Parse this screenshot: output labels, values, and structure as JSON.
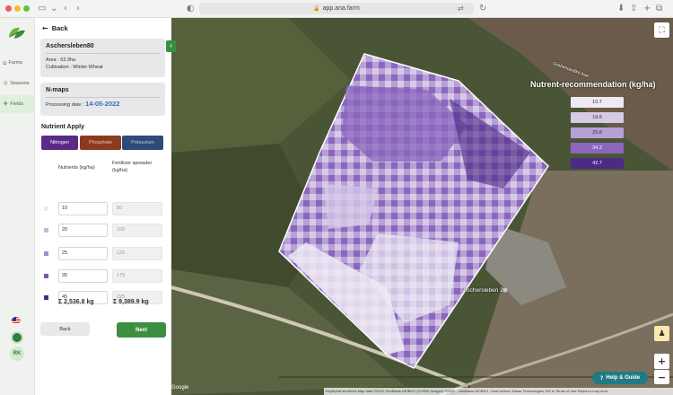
{
  "browser": {
    "url": "app.ana.farm"
  },
  "sidebar": {
    "items": [
      {
        "label": "Farms",
        "icon": "farm-icon"
      },
      {
        "label": "Seasons",
        "icon": "seasons-icon"
      },
      {
        "label": "Fields",
        "icon": "fields-icon",
        "active": true
      }
    ],
    "avatar_initials": "RK"
  },
  "panel": {
    "back_label": "Back",
    "field": {
      "name": "Aschersleben80",
      "area": "Area : 63.3ha",
      "cultivation": "Cultivation : Winter Wheat"
    },
    "nmaps": {
      "title": "N-maps",
      "processing_label": "Processing date :",
      "processing_date": "14-05-2022"
    },
    "nutrient_apply_title": "Nutrient Apply",
    "tabs": [
      {
        "label": "Nitrogen",
        "color": "#5b2a86",
        "active": true
      },
      {
        "label": "Phosphate",
        "color": "#8b3a1f"
      },
      {
        "label": "Potassium",
        "color": "#2f4a78"
      }
    ],
    "col_nutrients": "Nutrients (kg/ha)",
    "col_spreader": "Fertilizer spreader (kg/ha)",
    "rows": [
      {
        "nutrient": "10",
        "spreader": "50",
        "color": "#eeeaf4"
      },
      {
        "nutrient": "20",
        "spreader": "100",
        "color": "#c9b9df"
      },
      {
        "nutrient": "25",
        "spreader": "125",
        "color": "#a68bca"
      },
      {
        "nutrient": "35",
        "spreader": "175",
        "color": "#7c58ae"
      },
      {
        "nutrient": "45",
        "spreader": "225",
        "color": "#4c2a86"
      }
    ],
    "total_nutrients": "Σ 2,536.8 kg",
    "total_spreader": "Σ 9,389.9 kg",
    "back_button": "Back",
    "next_button": "Next"
  },
  "map": {
    "legend_title": "Nutrent-recommendation (kg/ha)",
    "legend": [
      {
        "value": "10.7",
        "color": "#eeeaf4"
      },
      {
        "value": "18.8",
        "color": "#d6cae7"
      },
      {
        "value": "25.8",
        "color": "#b7a0d6"
      },
      {
        "value": "34.3",
        "color": "#8a66bd"
      },
      {
        "value": "42.7",
        "color": "#4c2a86"
      }
    ],
    "place_label": "Aschersleben 2",
    "road_label": "Grabenrandke Aue",
    "help_label": "Help & Guide",
    "attribution": "Keyboard shortcuts   Map data ©2022 GeoBasis-DE/BKG (©2009) Imagery ©2022 , GeoBasis-DE/BKG, GeoContent, Maxar Technologies   100 m   Terms of Use   Report a map error",
    "google": "Google"
  }
}
